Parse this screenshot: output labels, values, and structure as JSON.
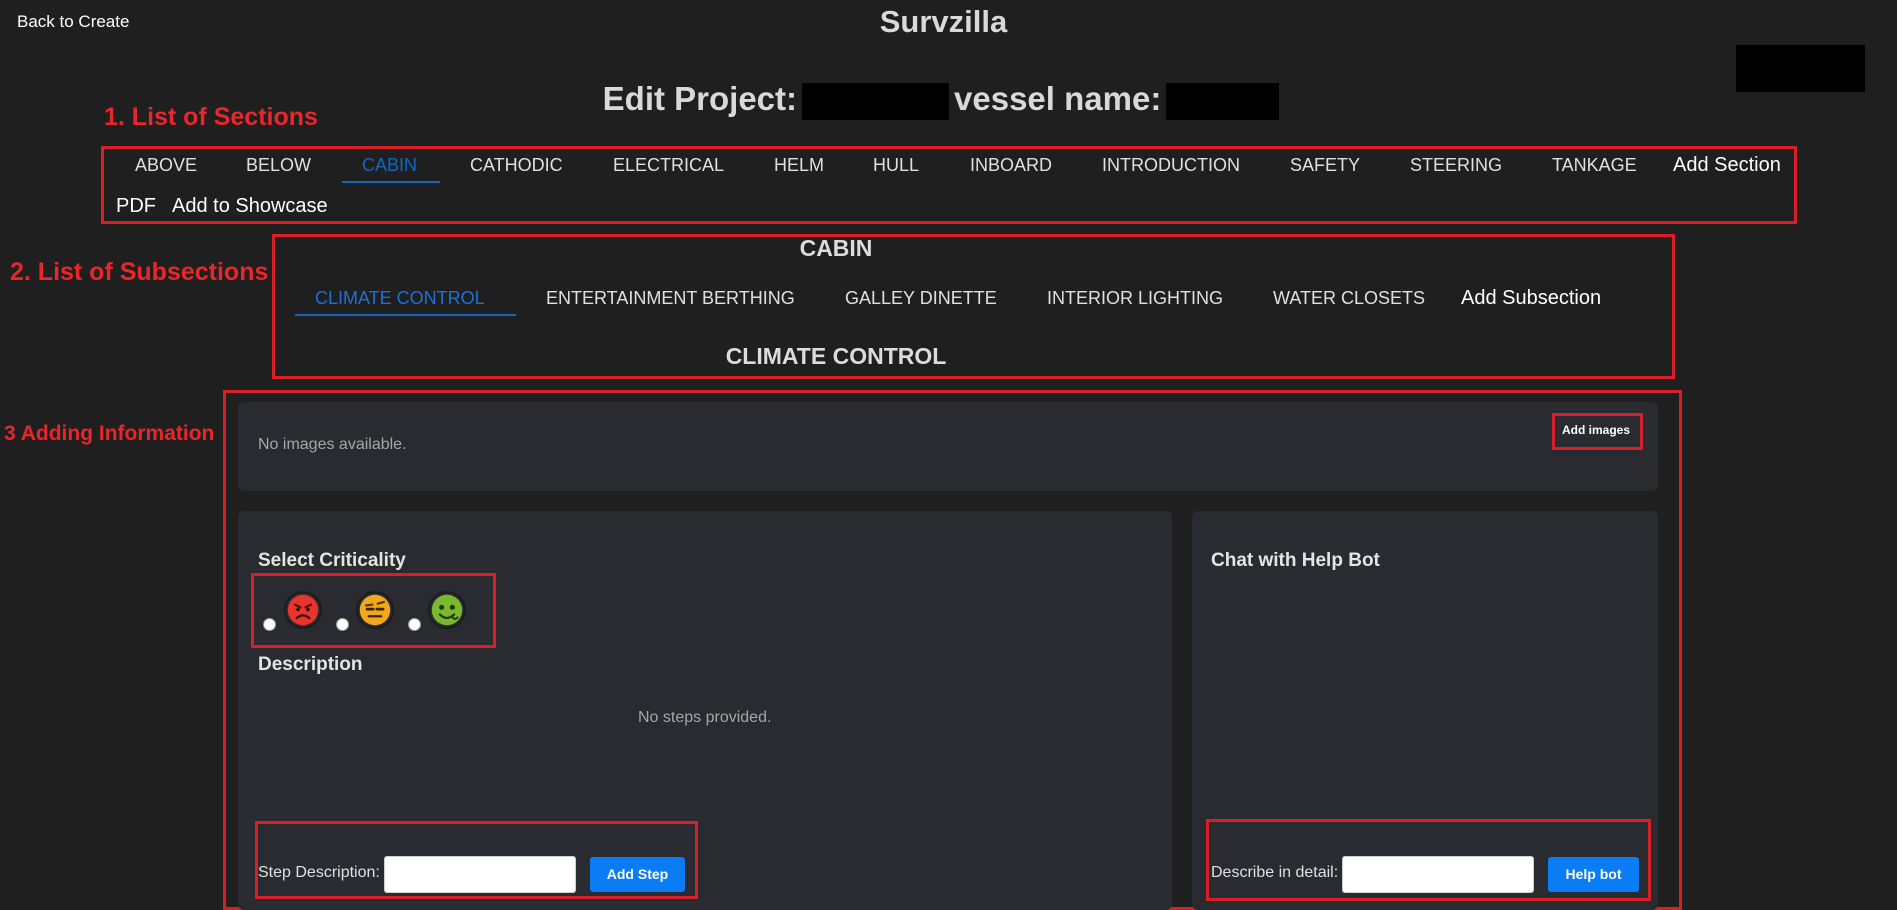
{
  "header": {
    "back_label": "Back to Create",
    "app_title": "Survzilla",
    "edit_label": "Edit Project:",
    "vessel_label": "vessel name:"
  },
  "annotations": {
    "sections": "1. List of Sections",
    "subsections": "2. List of Subsections",
    "adding_info": "3 Adding Information"
  },
  "sections": {
    "items": [
      "ABOVE",
      "BELOW",
      "CABIN",
      "CATHODIC",
      "ELECTRICAL",
      "HELM",
      "HULL",
      "INBOARD",
      "INTRODUCTION",
      "SAFETY",
      "STEERING",
      "TANKAGE"
    ],
    "active": "CABIN",
    "add_section_label": "Add Section",
    "pdf_label": "PDF",
    "showcase_label": "Add to Showcase"
  },
  "subsections": {
    "section_title": "CABIN",
    "items": [
      "CLIMATE CONTROL",
      "ENTERTAINMENT BERTHING",
      "GALLEY DINETTE",
      "INTERIOR LIGHTING",
      "WATER CLOSETS"
    ],
    "active": "CLIMATE CONTROL",
    "add_subsection_label": "Add Subsection",
    "current_title": "CLIMATE CONTROL"
  },
  "images_panel": {
    "empty_text": "No images available.",
    "add_images_label": "Add images"
  },
  "criticality_panel": {
    "title": "Select Criticality",
    "options": [
      {
        "icon": "angry-face-icon",
        "color": "#e8342b"
      },
      {
        "icon": "unamused-face-icon",
        "color": "#f2a81d"
      },
      {
        "icon": "nauseated-face-icon",
        "color": "#7cb82f"
      }
    ],
    "description_title": "Description",
    "empty_steps": "No steps provided.",
    "step_label": "Step Description:",
    "step_value": "",
    "add_step_label": "Add Step"
  },
  "chat_panel": {
    "title": "Chat with Help Bot",
    "describe_label": "Describe in detail:",
    "describe_value": "",
    "help_bot_label": "Help bot"
  },
  "colors": {
    "background": "#1f1f1f",
    "card": "#2a2b30",
    "accent": "#1565c0",
    "button": "#0a7cf5",
    "annotation_red": "#d61f26"
  }
}
